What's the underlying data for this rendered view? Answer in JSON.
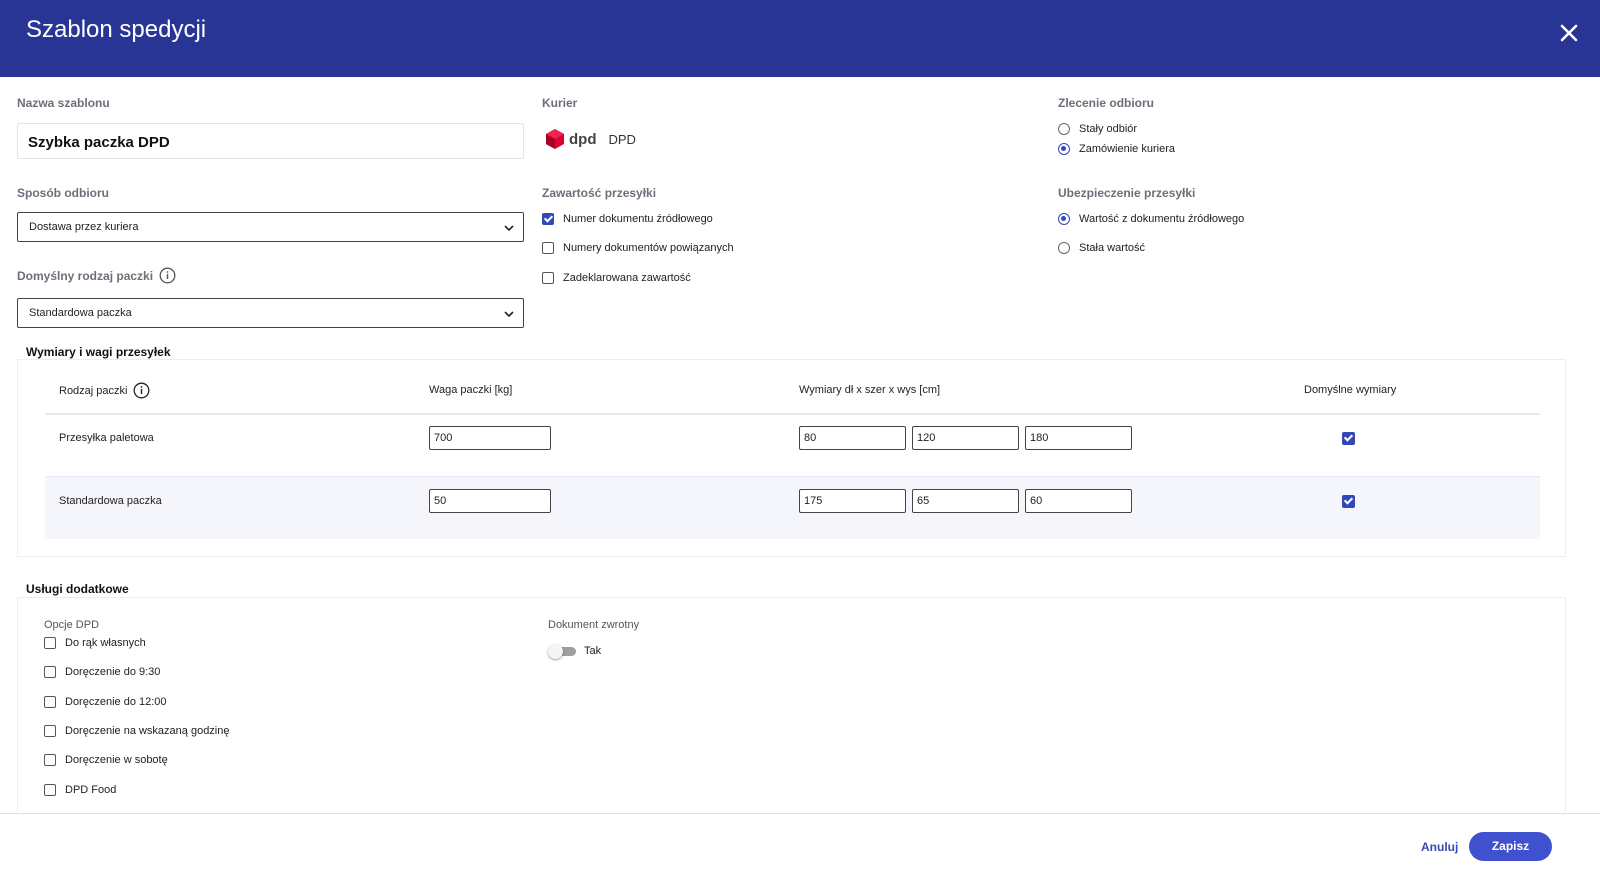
{
  "header": {
    "title": "Szablon spedycji",
    "close_icon": "close-icon"
  },
  "template_name": {
    "label": "Nazwa szablonu",
    "value": "Szybka paczka DPD"
  },
  "courier": {
    "label": "Kurier",
    "logo_text": "dpd",
    "name": "DPD",
    "brand_color": "#dc0032"
  },
  "pickup_order": {
    "label": "Zlecenie odbioru",
    "options": [
      {
        "label": "Stały odbiór",
        "selected": false
      },
      {
        "label": "Zamówienie kuriera",
        "selected": true
      }
    ]
  },
  "pickup_method": {
    "label": "Sposób odbioru",
    "value": "Dostawa przez kuriera"
  },
  "default_package_type": {
    "label": "Domyślny rodzaj paczki",
    "value": "Standardowa paczka"
  },
  "shipment_contents": {
    "label": "Zawartość przesyłki",
    "options": [
      {
        "label": "Numer dokumentu źródłowego",
        "checked": true
      },
      {
        "label": "Numery dokumentów powiązanych",
        "checked": false
      },
      {
        "label": "Zadeklarowana zawartość",
        "checked": false
      }
    ]
  },
  "insurance": {
    "label": "Ubezpieczenie przesyłki",
    "options": [
      {
        "label": "Wartość z dokumentu źródłowego",
        "selected": true
      },
      {
        "label": "Stała wartość",
        "selected": false
      }
    ]
  },
  "dimensions": {
    "title": "Wymiary i wagi przesyłek",
    "columns": [
      "Rodzaj paczki",
      "Waga paczki [kg]",
      "Wymiary dł x szer x wys [cm]",
      "Domyślne wymiary"
    ],
    "rows": [
      {
        "type": "Przesyłka paletowa",
        "weight": "700",
        "length": "80",
        "width": "120",
        "height": "180",
        "default": true
      },
      {
        "type": "Standardowa paczka",
        "weight": "50",
        "length": "175",
        "width": "65",
        "height": "60",
        "default": true
      }
    ]
  },
  "extra_services": {
    "title": "Usługi dodatkowe",
    "dpd_options": {
      "label": "Opcje DPD",
      "items": [
        {
          "label": "Do rąk własnych",
          "checked": false
        },
        {
          "label": "Doręczenie do 9:30",
          "checked": false
        },
        {
          "label": "Doręczenie do 12:00",
          "checked": false
        },
        {
          "label": "Doręczenie na wskazaną godzinę",
          "checked": false
        },
        {
          "label": "Doręczenie w sobotę",
          "checked": false
        },
        {
          "label": "DPD Food",
          "checked": false
        }
      ]
    },
    "return_document": {
      "label": "Dokument zwrotny",
      "toggle_label": "Tak",
      "on": false
    }
  },
  "footer": {
    "cancel_label": "Anuluj",
    "save_label": "Zapisz"
  },
  "colors": {
    "header_bg": "#293594",
    "accent": "#3f51cf",
    "checkbox": "#3348b8"
  }
}
